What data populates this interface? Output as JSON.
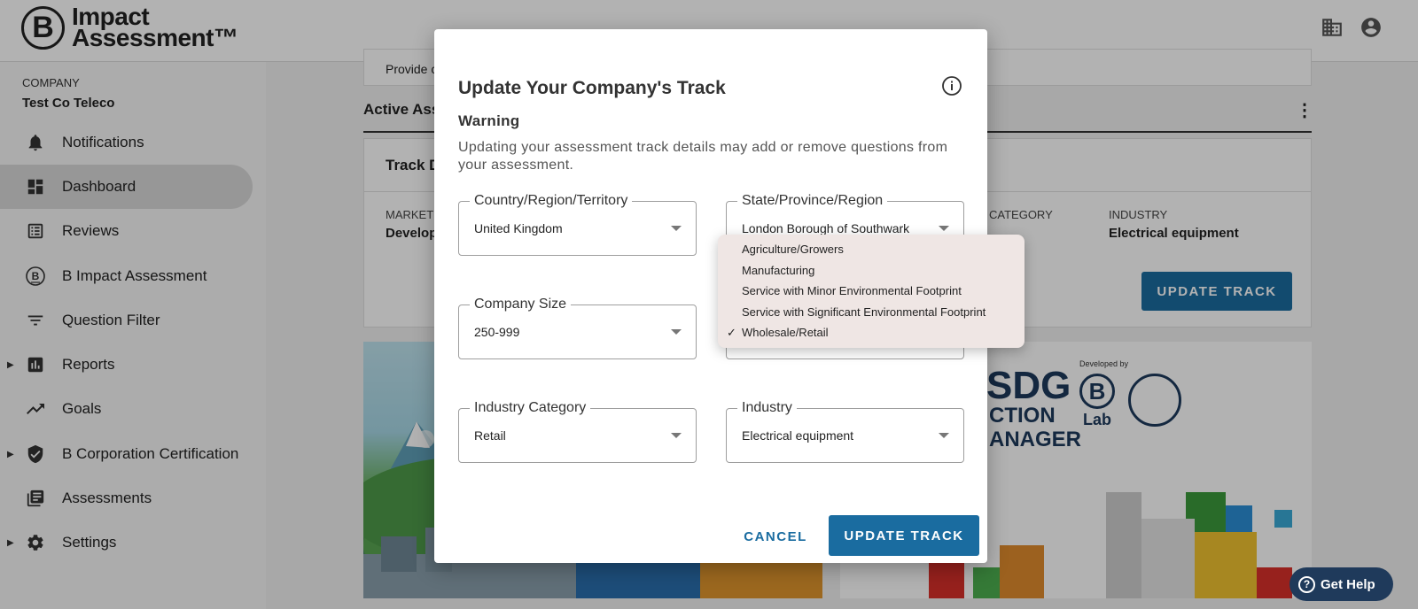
{
  "app": {
    "logo_letter": "B",
    "logo_line1": "Impact",
    "logo_line2": "Assessment™"
  },
  "sidebar": {
    "company_label": "COMPANY",
    "company_name": "Test Co Teleco",
    "items": [
      {
        "label": "Notifications",
        "icon": "bell-icon",
        "has_caret": false,
        "active": false
      },
      {
        "label": "Dashboard",
        "icon": "dashboard-icon",
        "has_caret": false,
        "active": true
      },
      {
        "label": "Reviews",
        "icon": "reviews-icon",
        "has_caret": false,
        "active": false
      },
      {
        "label": "B Impact Assessment",
        "icon": "b-logo-icon",
        "has_caret": false,
        "active": false
      },
      {
        "label": "Question Filter",
        "icon": "filter-icon",
        "has_caret": false,
        "active": false
      },
      {
        "label": "Reports",
        "icon": "bar-chart-icon",
        "has_caret": true,
        "active": false
      },
      {
        "label": "Goals",
        "icon": "trending-up-icon",
        "has_caret": false,
        "active": false
      },
      {
        "label": "B Corporation Certification",
        "icon": "shield-check-icon",
        "has_caret": true,
        "active": false
      },
      {
        "label": "Assessments",
        "icon": "library-books-icon",
        "has_caret": false,
        "active": false
      },
      {
        "label": "Settings",
        "icon": "gear-icon",
        "has_caret": true,
        "active": false
      }
    ]
  },
  "main": {
    "top_card_text": "Provide c",
    "active_heading": "Active Ass",
    "track_card": {
      "title": "Track D",
      "market_label": "MARKET",
      "market_value": "Develop",
      "category_label": "CATEGORY",
      "industry_label": "INDUSTRY",
      "industry_value": "Electrical equipment",
      "button": "UPDATE TRACK"
    },
    "banner_right": {
      "sdg_line1": "SDG",
      "sdg_line2": "CTION",
      "sdg_line3": "ANAGER",
      "developed_by": "Developed by",
      "blab": "Lab"
    }
  },
  "modal": {
    "title": "Update Your Company's Track",
    "warning_heading": "Warning",
    "warning_text": "Updating your assessment track details may add or remove questions from your assessment.",
    "fields": {
      "country": {
        "label": "Country/Region/Territory",
        "value": "United Kingdom"
      },
      "state": {
        "label": "State/Province/Region",
        "value": "London Borough of Southwark"
      },
      "company_size": {
        "label": "Company Size",
        "value": "250-999"
      },
      "industry_category": {
        "label": "Industry Category",
        "value": "Retail"
      },
      "industry": {
        "label": "Industry",
        "value": "Electrical equipment"
      }
    },
    "cancel_button": "CANCEL",
    "update_button": "UPDATE TRACK"
  },
  "dropdown": {
    "options": [
      {
        "label": "Agriculture/Growers",
        "selected": false
      },
      {
        "label": "Manufacturing",
        "selected": false
      },
      {
        "label": "Service with Minor Environmental Footprint",
        "selected": false
      },
      {
        "label": "Service with Significant Environmental Footprint",
        "selected": false
      },
      {
        "label": "Wholesale/Retail",
        "selected": true
      }
    ]
  },
  "help": {
    "label": "Get Help"
  },
  "colors": {
    "accent": "#1a6ca0",
    "help_bg": "#1f3a5b"
  }
}
